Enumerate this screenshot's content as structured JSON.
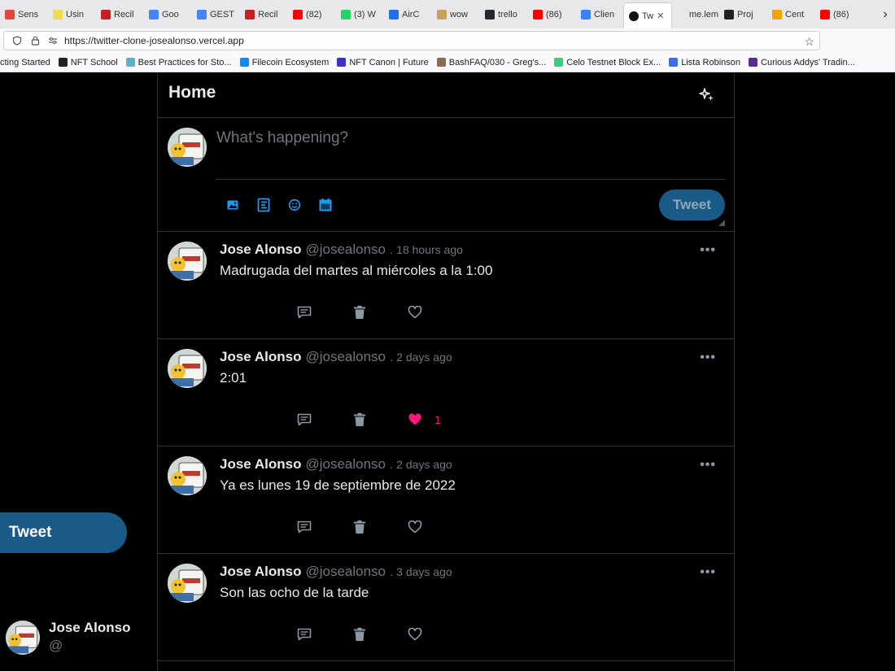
{
  "browser": {
    "tabs": [
      {
        "label": "Sens",
        "color": "#e0463c"
      },
      {
        "label": "Usin",
        "color": "#f0db4f"
      },
      {
        "label": "Recil",
        "color": "#c5221f"
      },
      {
        "label": "Goo",
        "color": "#4285f4"
      },
      {
        "label": "GEST",
        "color": "#4285f4"
      },
      {
        "label": "Recil",
        "color": "#c5221f"
      },
      {
        "label": "(82)",
        "color": "#ff0000"
      },
      {
        "label": "(3) W",
        "color": "#25d366"
      },
      {
        "label": "AirC",
        "color": "#1f6feb"
      },
      {
        "label": "wow",
        "color": "#c8a25a"
      },
      {
        "label": "trello",
        "color": "#24292f"
      },
      {
        "label": "(86)",
        "color": "#ff0000"
      },
      {
        "label": "Clien",
        "color": "#3b82f6"
      },
      {
        "label": "Tw",
        "color": "#111111",
        "active": true
      },
      {
        "label": "me.lem",
        "color": "#e8e8ea"
      },
      {
        "label": "Proj",
        "color": "#222222"
      },
      {
        "label": "Cent",
        "color": "#f4a300"
      },
      {
        "label": "(86)",
        "color": "#ff0000"
      }
    ],
    "url": "https://twitter-clone-josealonso.vercel.app",
    "bookmarks": [
      {
        "label": "cting Started",
        "color": ""
      },
      {
        "label": "NFT School",
        "color": "#222222"
      },
      {
        "label": "Best Practices for Sto...",
        "color": "#5ab0c8"
      },
      {
        "label": "Filecoin Ecosystem",
        "color": "#0090ff"
      },
      {
        "label": "NFT Canon | Future",
        "color": "#3a2fd0"
      },
      {
        "label": "BashFAQ/030 - Greg's...",
        "color": "#8b6b4a"
      },
      {
        "label": "Celo Testnet Block Ex...",
        "color": "#35d07f"
      },
      {
        "label": "Lista Robinson",
        "color": "#3a6ee8"
      },
      {
        "label": "Curious Addys' Tradin...",
        "color": "#5b2d8e"
      }
    ]
  },
  "home": {
    "title": "Home",
    "compose_placeholder": "What's happening?",
    "tweet_button": "Tweet"
  },
  "posts": [
    {
      "name": "Jose Alonso",
      "handle": "@josealonso",
      "dot": ".",
      "time": "18 hours ago",
      "text": "Madrugada del martes al miércoles a la 1:00",
      "liked": false,
      "likes": ""
    },
    {
      "name": "Jose Alonso",
      "handle": "@josealonso",
      "dot": ".",
      "time": "2 days ago",
      "text": "2:01",
      "liked": true,
      "likes": "1"
    },
    {
      "name": "Jose Alonso",
      "handle": "@josealonso",
      "dot": ".",
      "time": "2 days ago",
      "text": "Ya es lunes 19 de septiembre de 2022",
      "liked": false,
      "likes": ""
    },
    {
      "name": "Jose Alonso",
      "handle": "@josealonso",
      "dot": ".",
      "time": "3 days ago",
      "text": "Son las ocho de la tarde",
      "liked": false,
      "likes": ""
    }
  ],
  "sidebar": {
    "tweet_button": "Tweet",
    "user_name": "Jose Alonso",
    "user_handle": "@"
  },
  "colors": {
    "accent": "#1a5a86",
    "icon_blue": "#1d9bf0",
    "like_pink": "#f91880",
    "muted": "#71767b"
  },
  "icons": [
    "sparkle-icon",
    "image-icon",
    "poll-icon",
    "emoji-icon",
    "schedule-icon",
    "comment-icon",
    "trash-icon",
    "heart-icon",
    "more-icon"
  ]
}
